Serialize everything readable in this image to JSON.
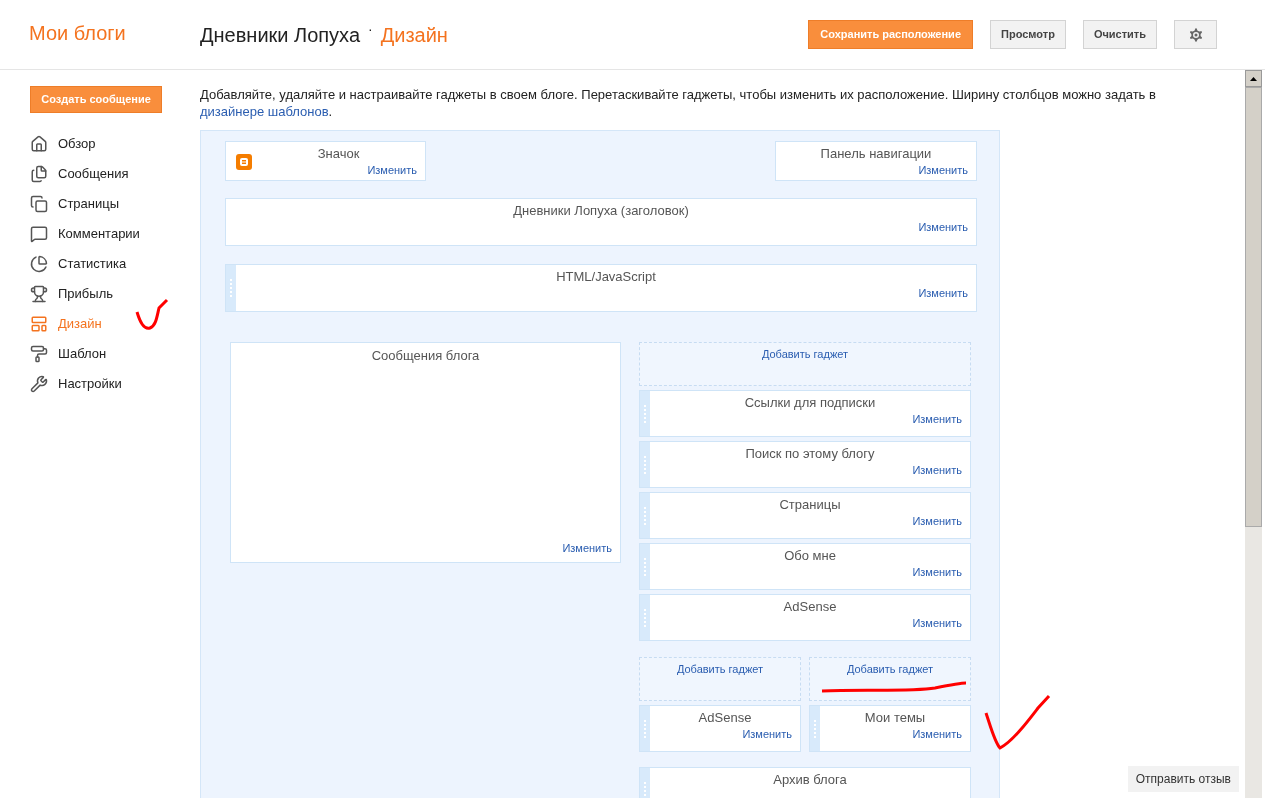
{
  "header": {
    "brand": "Мои блоги",
    "blog_title": "Дневники Лопуха",
    "separator": "·",
    "section": "Дизайн",
    "buttons": [
      {
        "kind": "primary",
        "label": "Сохранить расположение"
      },
      {
        "kind": "default",
        "label": "Просмотр"
      },
      {
        "kind": "default",
        "label": "Очистить"
      },
      {
        "kind": "settings"
      }
    ]
  },
  "sidebar": {
    "create_button": "Создать сообщение",
    "items": [
      {
        "label": "Обзор",
        "selected": false
      },
      {
        "label": "Сообщения",
        "selected": false
      },
      {
        "label": "Страницы",
        "selected": false
      },
      {
        "label": "Комментарии",
        "selected": false
      },
      {
        "label": "Статистика",
        "selected": false
      },
      {
        "label": "Прибыль",
        "selected": false
      },
      {
        "label": "Дизайн",
        "selected": true
      },
      {
        "label": "Шаблон",
        "selected": false
      },
      {
        "label": "Настройки",
        "selected": false
      }
    ]
  },
  "intro": {
    "text": "Добавляйте, удаляйте и настраивайте гаджеты в своем блоге. Перетаскивайте гаджеты, чтобы изменить их расположение. Ширину столбцов можно задать в",
    "link": "дизайнере шаблонов",
    "end": "."
  },
  "layout": {
    "top_left": {
      "title": "Значок",
      "edit": "Изменить",
      "draggable": false
    },
    "top_right": {
      "title": "Панель навигации",
      "edit": "Изменить",
      "draggable": false
    },
    "header_gadget": {
      "title": "Дневники Лопуха (заголовок)",
      "edit": "Изменить",
      "draggable": false
    },
    "html_gadget": {
      "title": "HTML/JavaScript",
      "edit": "Изменить",
      "draggable": true
    },
    "main_column": {
      "title": "Сообщения блога",
      "edit": "Изменить"
    },
    "sidebar_column": {
      "add": "Добавить гаджет",
      "gadgets": [
        {
          "title": "Ссылки для подписки",
          "edit": "Изменить",
          "draggable": true
        },
        {
          "title": "Поиск по этому блогу",
          "edit": "Изменить",
          "draggable": true
        },
        {
          "title": "Страницы",
          "edit": "Изменить",
          "draggable": true
        },
        {
          "title": "Обо мне",
          "edit": "Изменить",
          "draggable": true
        },
        {
          "title": "AdSense",
          "edit": "Изменить",
          "draggable": true
        }
      ]
    },
    "footer_columns": [
      {
        "add": "Добавить гаджет",
        "gadgets": [
          {
            "title": "AdSense",
            "edit": "Изменить",
            "draggable": true
          }
        ]
      },
      {
        "add": "Добавить гаджет",
        "gadgets": [
          {
            "title": "Мои темы",
            "edit": "Изменить",
            "draggable": true
          }
        ]
      }
    ],
    "bottom_gadget": {
      "title": "Архив блога",
      "draggable": true
    }
  },
  "feedback_button": "Отправить отзыв"
}
